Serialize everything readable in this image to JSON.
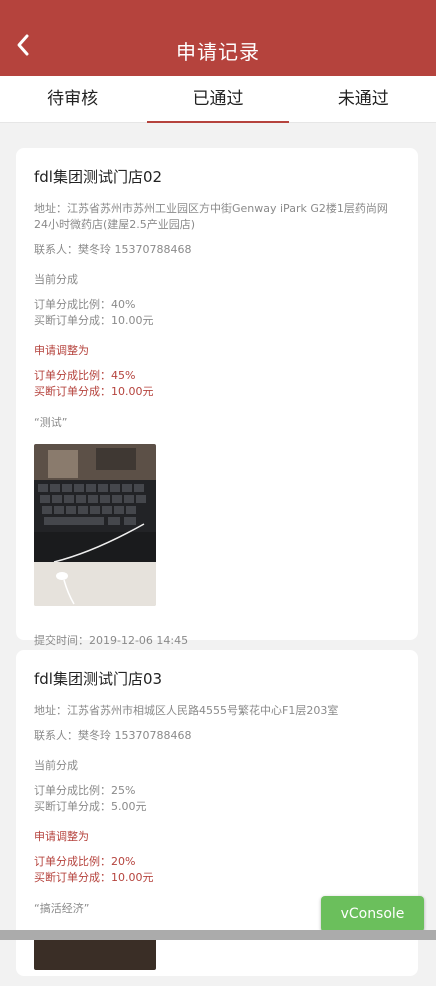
{
  "header": {
    "title": "申请记录",
    "back_icon": "chevron-left-icon"
  },
  "tabs": [
    {
      "label": "待审核",
      "active": false
    },
    {
      "label": "已通过",
      "active": true
    },
    {
      "label": "未通过",
      "active": false
    }
  ],
  "records": [
    {
      "store": "fdl集团测试门店02",
      "address": "地址：江苏省苏州市苏州工业园区方中街Genway iPark G2楼1层药尚网24小时微药店(建屋2.5产业园店)",
      "contact": "联系人：樊冬玲 15370788468",
      "current_label": "当前分成",
      "current_ratio": "订单分成比例：40%",
      "current_buyout": "买断订单分成：10.00元",
      "apply_label": "申请调整为",
      "apply_ratio": "订单分成比例：45%",
      "apply_buyout": "买断订单分成：10.00元",
      "remark": "“测试”",
      "submit_time": "提交时间：2019-12-06 14:45"
    },
    {
      "store": "fdl集团测试门店03",
      "address": "地址：江苏省苏州市相城区人民路4555号繁花中心F1层203室",
      "contact": "联系人：樊冬玲 15370788468",
      "current_label": "当前分成",
      "current_ratio": "订单分成比例：25%",
      "current_buyout": "买断订单分成：5.00元",
      "apply_label": "申请调整为",
      "apply_ratio": "订单分成比例：20%",
      "apply_buyout": "买断订单分成：10.00元",
      "remark": "“搞活经济”"
    }
  ],
  "vconsole": {
    "label": "vConsole"
  },
  "colors": {
    "brand": "#b5433d",
    "vconsole": "#6bbf5c"
  }
}
